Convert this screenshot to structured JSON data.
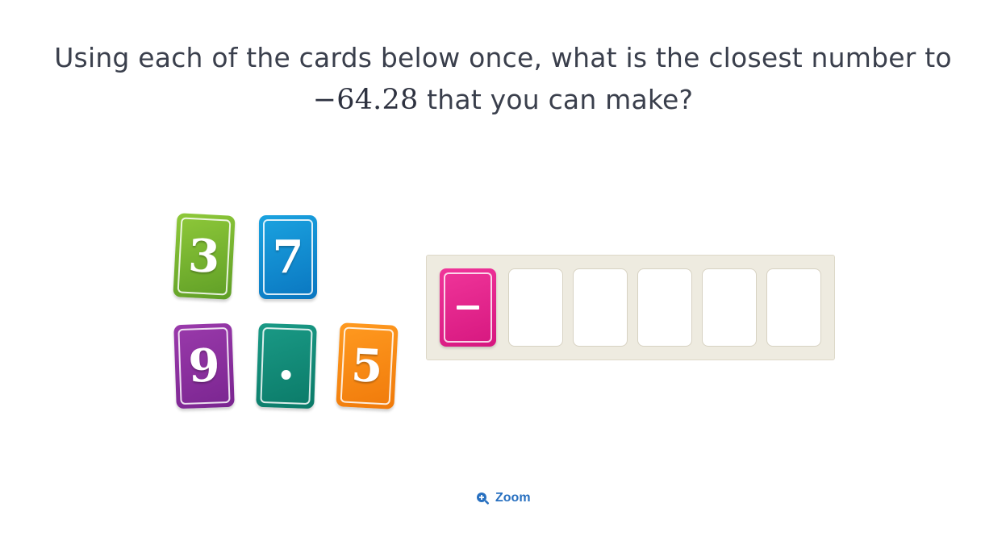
{
  "question": {
    "text_before": "Using each of the cards below once, what is the closest number to",
    "target_value": "−64.28",
    "text_after": "that you can make?"
  },
  "cards": [
    {
      "value": "3",
      "color": "#7ab332"
    },
    {
      "value": "7",
      "color": "#0e8fd6"
    },
    {
      "value": "9",
      "color": "#8a2f9e"
    },
    {
      "value": ".",
      "color": "#138c78"
    },
    {
      "value": "5",
      "color": "#f78a12"
    }
  ],
  "answer_tray": {
    "placed_card": {
      "value": "−",
      "color": "#e1248a"
    },
    "empty_slots": 5
  },
  "zoom": {
    "label": "Zoom",
    "icon": "zoom-in-icon"
  }
}
